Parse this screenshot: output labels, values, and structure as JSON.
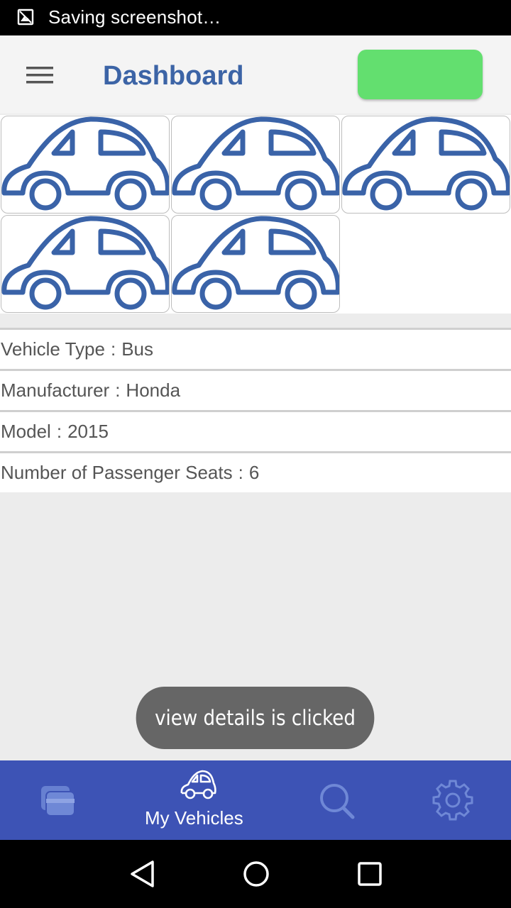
{
  "status_bar": {
    "text": "Saving screenshot…",
    "icon": "screenshot-icon"
  },
  "app_bar": {
    "title": "Dashboard",
    "menu_icon": "hamburger-menu-icon",
    "action_button_color": "#63df6f"
  },
  "vehicles": [
    {
      "icon": "car-icon"
    },
    {
      "icon": "car-icon"
    },
    {
      "icon": "car-icon"
    },
    {
      "icon": "car-icon"
    },
    {
      "icon": "car-icon"
    }
  ],
  "details": {
    "vehicle_type": {
      "label": "Vehicle Type",
      "value": "Bus"
    },
    "manufacturer": {
      "label": "Manufacturer",
      "value": "Honda"
    },
    "model": {
      "label": "Model",
      "value": "2015"
    },
    "seats": {
      "label": "Number of Passenger Seats",
      "value": "6"
    },
    "separator": ":"
  },
  "toast": {
    "text": "view details is clicked"
  },
  "bottom_nav": {
    "items": [
      {
        "icon": "cards-icon",
        "label": ""
      },
      {
        "icon": "car-icon",
        "label": "My Vehicles"
      },
      {
        "icon": "search-icon",
        "label": ""
      },
      {
        "icon": "gear-icon",
        "label": ""
      }
    ],
    "background": "#3d53b5"
  },
  "colors": {
    "accent": "#3c64a6",
    "car_stroke": "#3a63a8"
  }
}
